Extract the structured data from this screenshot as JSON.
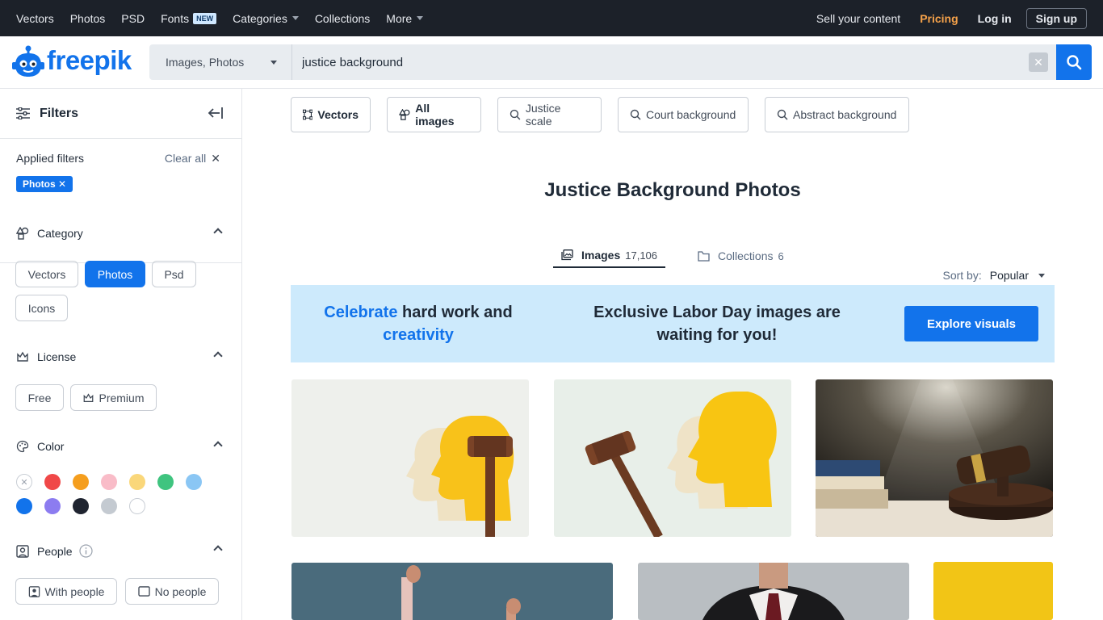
{
  "topnav": {
    "items": [
      {
        "label": "Vectors"
      },
      {
        "label": "Photos"
      },
      {
        "label": "PSD"
      },
      {
        "label": "Fonts",
        "badge": "NEW"
      },
      {
        "label": "Categories",
        "dropdown": true
      },
      {
        "label": "Collections"
      },
      {
        "label": "More",
        "dropdown": true
      }
    ],
    "sell": "Sell your content",
    "pricing": "Pricing",
    "login": "Log in",
    "signup": "Sign up"
  },
  "header": {
    "logo_text": "freepik",
    "search_type": "Images, Photos",
    "search_value": "justice background"
  },
  "sidebar": {
    "title": "Filters",
    "applied_label": "Applied filters",
    "clear_all": "Clear all",
    "applied_chip": "Photos",
    "category": {
      "title": "Category",
      "options": [
        "Vectors",
        "Photos",
        "Psd",
        "Icons"
      ],
      "selected": "Photos"
    },
    "license": {
      "title": "License",
      "options": [
        "Free",
        "Premium"
      ]
    },
    "color": {
      "title": "Color",
      "swatches": [
        "#ffffff",
        "#f04848",
        "#f59e1e",
        "#f9bcc8",
        "#fad77a",
        "#3fc47f",
        "#8ac6f4",
        "#1273eb",
        "#8c7cf0",
        "#1f2430",
        "#c4cad1",
        "#ffffff"
      ]
    },
    "people": {
      "title": "People",
      "options": [
        "With people",
        "No people"
      ]
    }
  },
  "main": {
    "tags": [
      "Vectors",
      "All images",
      "Justice scale",
      "Court background",
      "Abstract background"
    ],
    "title": "Justice Background Photos",
    "tabs": [
      {
        "label": "Images",
        "count": "17,106"
      },
      {
        "label": "Collections",
        "count": "6"
      }
    ],
    "sort_label": "Sort by:",
    "sort_value": "Popular",
    "banner": {
      "line1_a": "Celebrate",
      "line1_b": " hard work and",
      "line2": "creativity",
      "center": "Exclusive Labor Day images are waiting for you!",
      "button": "Explore visuals"
    }
  },
  "colors": {
    "brand": "#1273eb",
    "topbar": "#1c2129",
    "pricing": "#f6a24a",
    "banner": "#cdeafc"
  }
}
